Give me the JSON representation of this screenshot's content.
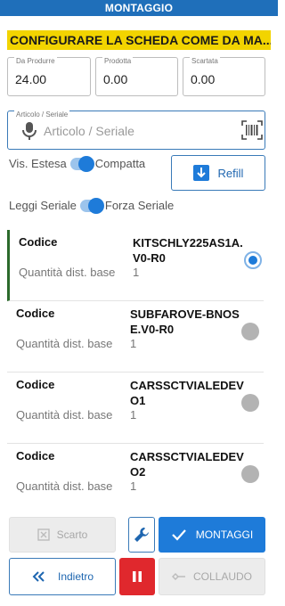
{
  "header": {
    "title": "MONTAGGIO"
  },
  "warning": {
    "text": "CONFIGURARE LA SCHEDA COME DA MA..."
  },
  "quantities": [
    {
      "label": "Da Produrre",
      "value": "24.00"
    },
    {
      "label": "Prodotta",
      "value": "0.00"
    },
    {
      "label": "Scartata",
      "value": "0.00"
    }
  ],
  "article": {
    "label": "Articolo / Seriale",
    "placeholder": "Articolo / Seriale"
  },
  "toggles": {
    "vis_left": "Vis. Estesa",
    "vis_right": "Compatta",
    "read_left": "Leggi Seriale",
    "read_right": "Forza Seriale"
  },
  "refill": {
    "label": "Refill"
  },
  "rows": [
    {
      "code_label": "Codice",
      "code": "KITSCHLY225AS1A.V0-R0",
      "qty_label": "Quantità dist. base",
      "qty": "1"
    },
    {
      "code_label": "Codice",
      "code": "SUBFAROVE-BNOSE.V0-R0",
      "qty_label": "Quantità dist. base",
      "qty": "1"
    },
    {
      "code_label": "Codice",
      "code": "CARSSCTVIALEDEVO1",
      "qty_label": "Quantità dist. base",
      "qty": "1"
    },
    {
      "code_label": "Codice",
      "code": "CARSSCTVIALEDEVO2",
      "qty_label": "Quantità dist. base",
      "qty": "1"
    }
  ],
  "buttons": {
    "scarto": "Scarto",
    "montaggi": "MONTAGGI",
    "indietro": "Indietro",
    "collaudo": "COLLAUDO"
  },
  "colors": {
    "primary": "#1e7bd9",
    "header": "#1f6fba",
    "warning": "#f2d400",
    "danger": "#e0282d"
  }
}
